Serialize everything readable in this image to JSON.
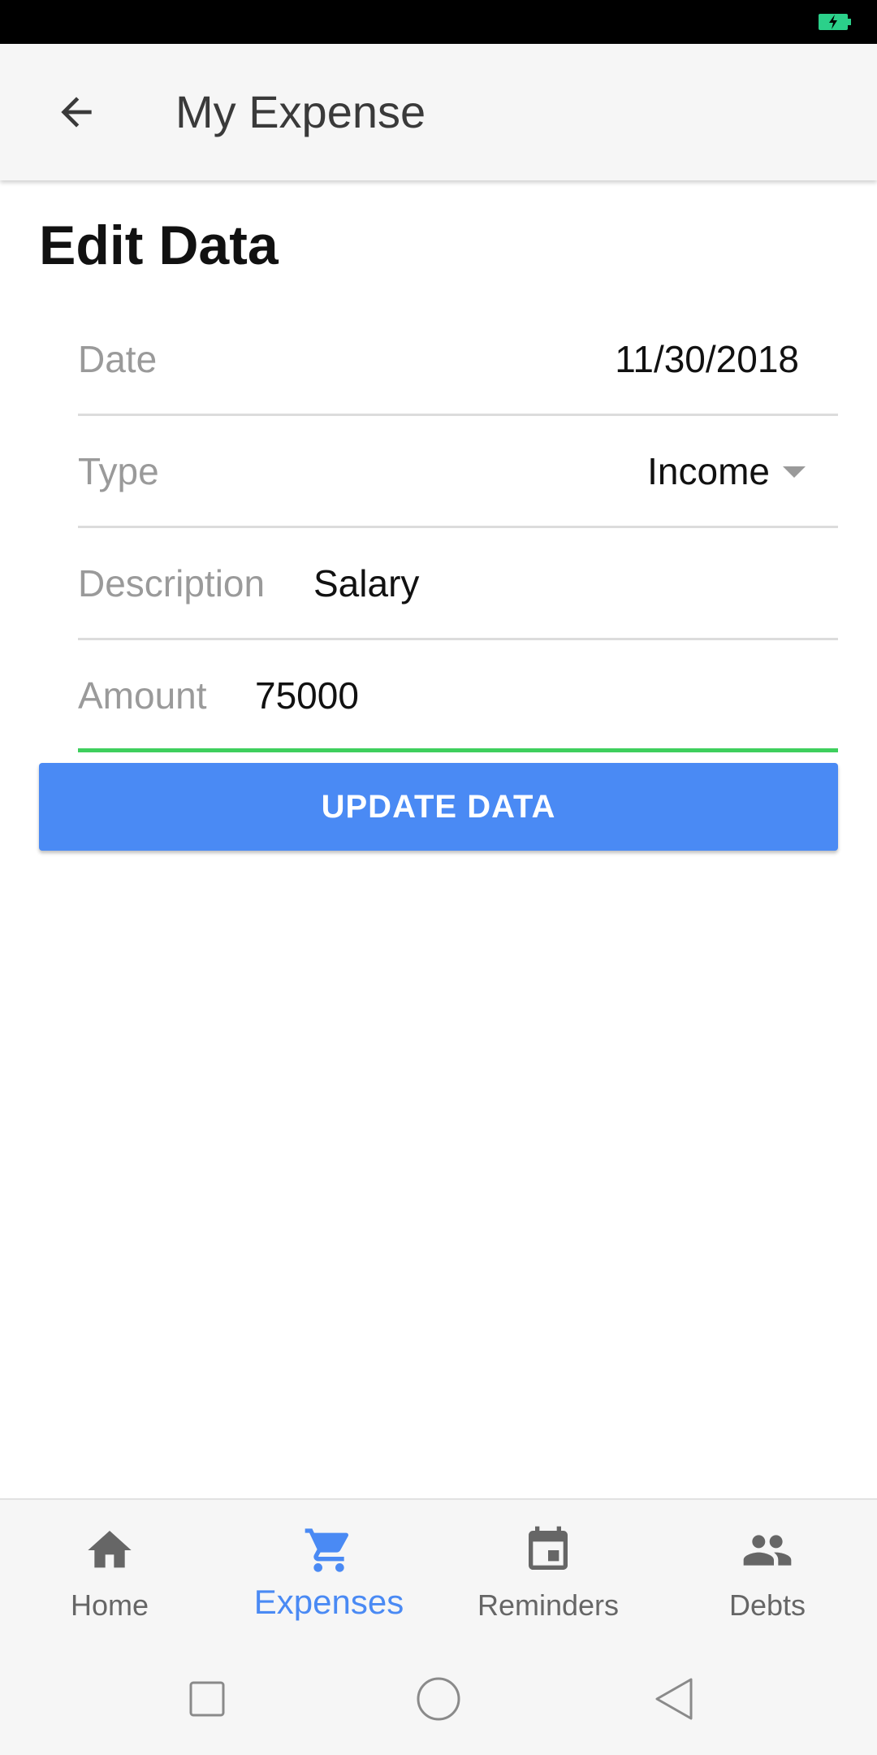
{
  "app_bar": {
    "title": "My Expense",
    "back_icon": "arrow-left-icon"
  },
  "page": {
    "heading": "Edit Data"
  },
  "form": {
    "date": {
      "label": "Date",
      "value": "11/30/2018"
    },
    "type": {
      "label": "Type",
      "value": "Income",
      "caret_icon": "dropdown-caret-icon"
    },
    "description": {
      "label": "Description",
      "value": "Salary"
    },
    "amount": {
      "label": "Amount",
      "value": "75000"
    },
    "submit_label": "UPDATE DATA"
  },
  "bottom_nav": {
    "active": "Expenses",
    "items": [
      {
        "label": "Home",
        "icon": "home-icon"
      },
      {
        "label": "Expenses",
        "icon": "cart-icon"
      },
      {
        "label": "Reminders",
        "icon": "calendar-icon"
      },
      {
        "label": "Debts",
        "icon": "people-icon"
      }
    ]
  },
  "colors": {
    "accent": "#4a8af4",
    "focus_underline": "#3ecf5d",
    "battery": "#2bd08a"
  }
}
